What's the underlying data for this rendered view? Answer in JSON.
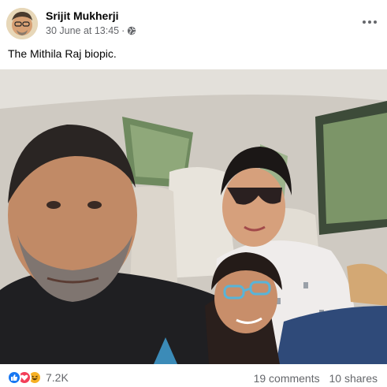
{
  "post": {
    "author": "Srijit Mukherji",
    "timestamp": "30 June at 13:45",
    "separator": "·",
    "privacy_icon": "globe-icon",
    "menu_icon": "more-options-icon",
    "caption": "The Mithila Raj biopic."
  },
  "footer": {
    "reactions": [
      "like-icon",
      "love-icon",
      "haha-icon"
    ],
    "reaction_count": "7.2K",
    "comments": "19 comments",
    "shares": "10 shares"
  },
  "colors": {
    "like": "#1877f2",
    "love": "#f33e58",
    "haha": "#f7b125",
    "muted_text": "#65676b"
  }
}
